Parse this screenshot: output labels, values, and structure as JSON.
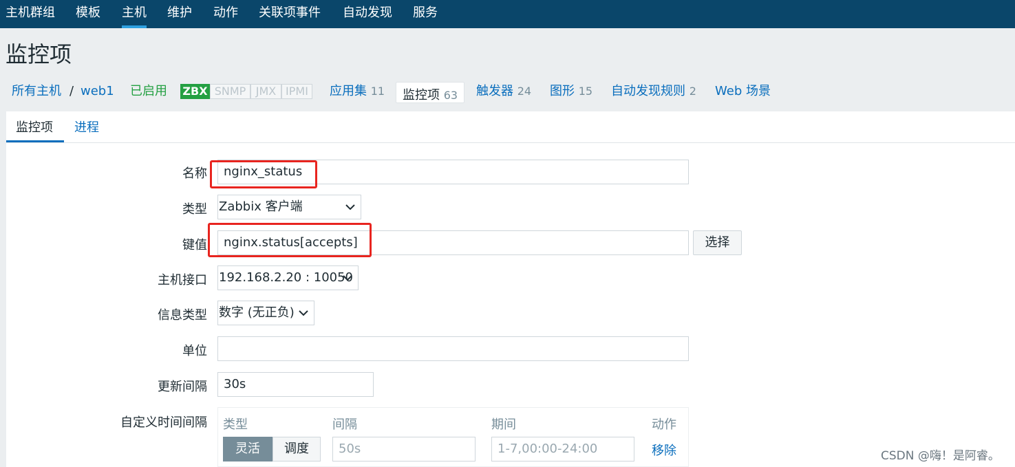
{
  "topnav": {
    "items": [
      "主机群组",
      "模板",
      "主机",
      "维护",
      "动作",
      "关联项事件",
      "自动发现",
      "服务"
    ]
  },
  "page_title": "监控项",
  "breadcrumb": {
    "all_hosts": "所有主机",
    "separator": "/",
    "host": "web1",
    "status": "已启用",
    "availability": [
      "ZBX",
      "SNMP",
      "JMX",
      "IPMI"
    ],
    "apps_label": "应用集",
    "apps_count": "11",
    "items_label": "监控项",
    "items_count": "63",
    "triggers_label": "触发器",
    "triggers_count": "24",
    "graphs_label": "图形",
    "graphs_count": "15",
    "discovery_label": "自动发现规则",
    "discovery_count": "2",
    "web_label": "Web 场景"
  },
  "tabs": {
    "items": "监控项",
    "process": "进程"
  },
  "form": {
    "name_label": "名称",
    "name_value": "nginx_status",
    "type_label": "类型",
    "type_value": "Zabbix 客户端",
    "key_label": "键值",
    "key_value": "nginx.status[accepts]",
    "select_button": "选择",
    "iface_label": "主机接口",
    "iface_value": "192.168.2.20 : 10050",
    "info_label": "信息类型",
    "info_value": "数字 (无正负)",
    "unit_label": "单位",
    "unit_value": "",
    "interval_label": "更新间隔",
    "interval_value": "30s",
    "custom_label": "自定义时间间隔",
    "custom": {
      "col_type": "类型",
      "col_interval": "间隔",
      "col_period": "期间",
      "col_action": "动作",
      "flex": "灵活",
      "schedule": "调度",
      "interval_placeholder": "50s",
      "period_placeholder": "1-7,00:00-24:00",
      "remove": "移除"
    }
  },
  "watermark": "CSDN @嗨！是阿睿。",
  "colors": {
    "nav_bg": "#0a466a",
    "link": "#0a6ebd",
    "enabled": "#24a042",
    "highlight": "#e8241f"
  }
}
